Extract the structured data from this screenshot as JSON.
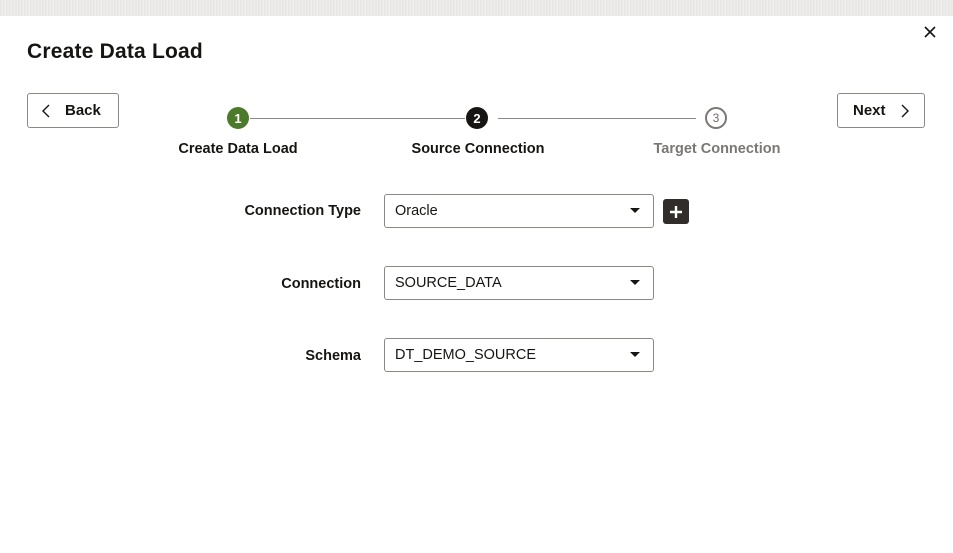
{
  "dialog": {
    "title": "Create Data Load",
    "close_icon": "close-icon"
  },
  "nav": {
    "back_label": "Back",
    "next_label": "Next"
  },
  "steps": [
    {
      "number": "1",
      "label": "Create Data Load",
      "state": "completed",
      "color": "#4c7a2a"
    },
    {
      "number": "2",
      "label": "Source Connection",
      "state": "current",
      "color": "#161513"
    },
    {
      "number": "3",
      "label": "Target Connection",
      "state": "future",
      "color": "#7a7774"
    }
  ],
  "form": {
    "connection_type": {
      "label": "Connection Type",
      "value": "Oracle"
    },
    "connection": {
      "label": "Connection",
      "value": "SOURCE_DATA"
    },
    "schema": {
      "label": "Schema",
      "value": "DT_DEMO_SOURCE"
    },
    "add_icon": "plus-icon"
  }
}
